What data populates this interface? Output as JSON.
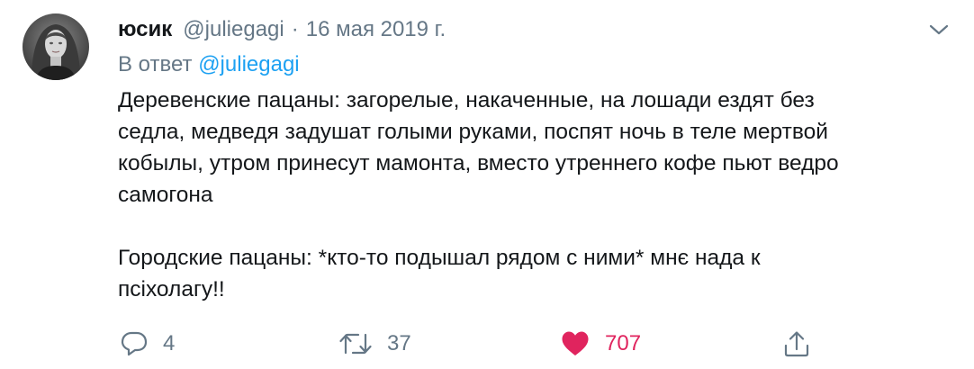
{
  "tweet": {
    "author_name": "юсик",
    "author_handle": "@juliegagi",
    "separator": "·",
    "date": "16 мая 2019 г.",
    "reply_prefix": "В ответ",
    "reply_to": "@juliegagi",
    "text": "Деревенские пацаны: загорелые, накаченные, на лошади ездят без\nседла, медведя задушат голыми руками, поспят ночь в теле мертвой\nкобылы, утром принесут мамонта, вместо утреннего кофе пьют ведро\nсамогона\n\nГородские пацаны: *кто-то подышал рядом с ними* мнє нада к\nпсіхолагу!!",
    "icons": {
      "reply": "reply-icon",
      "retweet": "retweet-icon",
      "like": "heart-icon",
      "share": "share-icon",
      "menu": "chevron-down-icon"
    },
    "stats": {
      "replies": "4",
      "retweets": "37",
      "likes": "707"
    },
    "colors": {
      "secondary": "#657786",
      "link": "#1da1f2",
      "like": "#e0245e"
    }
  }
}
